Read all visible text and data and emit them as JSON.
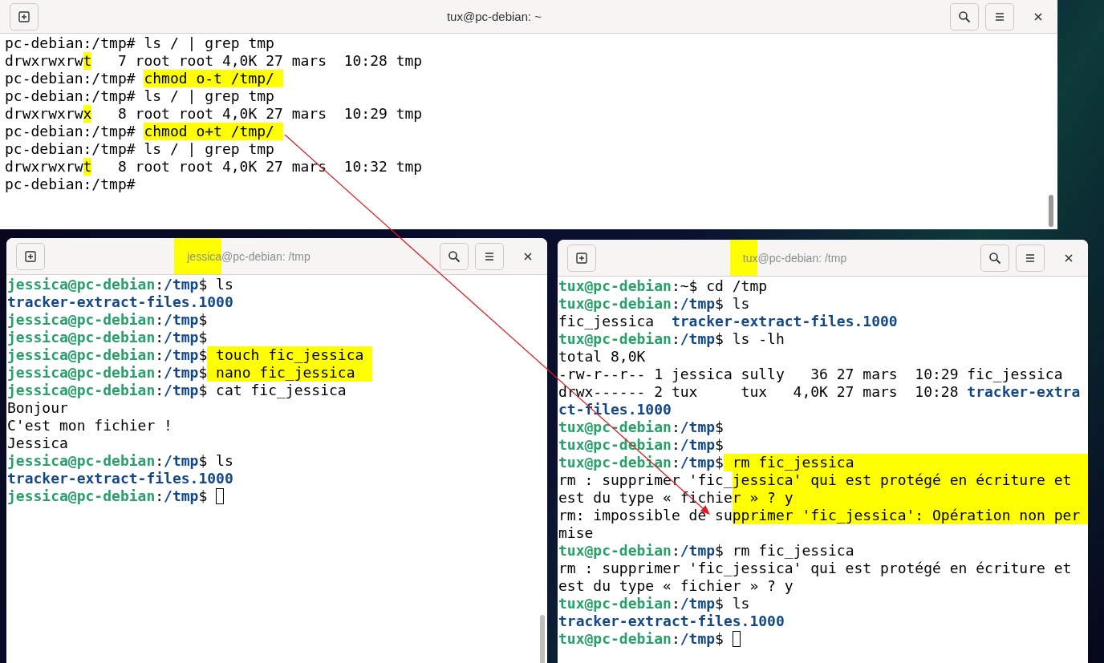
{
  "windows": [
    {
      "title": [
        {
          "text": "tux@pc-debian: ~",
          "kind": "plain"
        }
      ],
      "lines": [
        {
          "segments": [
            {
              "text": "pc-debian:/tmp# ls / | grep tmp",
              "kind": "plain"
            }
          ]
        },
        {
          "segments": [
            {
              "text": "drwxrwxrw",
              "kind": "plain"
            },
            {
              "text": "t",
              "kind": "marked"
            },
            {
              "text": "   7 root root 4,0K 27 mars  10:28 tmp",
              "kind": "plain"
            }
          ]
        },
        {
          "segments": [
            {
              "text": "pc-debian:/tmp# ",
              "kind": "plain"
            },
            {
              "text": "chmod o-t /tmp/ ",
              "kind": "marked"
            }
          ]
        },
        {
          "segments": [
            {
              "text": "pc-debian:/tmp# ls / | grep tmp",
              "kind": "plain"
            }
          ]
        },
        {
          "segments": [
            {
              "text": "drwxrwxrw",
              "kind": "plain"
            },
            {
              "text": "x",
              "kind": "marked"
            },
            {
              "text": "   8 root root 4,0K 27 mars  10:29 tmp",
              "kind": "plain"
            }
          ]
        },
        {
          "segments": [
            {
              "text": "pc-debian:/tmp# ",
              "kind": "plain"
            },
            {
              "text": "chmod o+t /tmp/ ",
              "kind": "marked"
            }
          ]
        },
        {
          "segments": [
            {
              "text": "pc-debian:/tmp# ls / | grep tmp",
              "kind": "plain"
            }
          ]
        },
        {
          "segments": [
            {
              "text": "drwxrwxrw",
              "kind": "plain"
            },
            {
              "text": "t",
              "kind": "marked"
            },
            {
              "text": "   8 root root 4,0K 27 mars  10:32 tmp",
              "kind": "plain"
            }
          ]
        },
        {
          "segments": [
            {
              "text": "pc-debian:/tmp#",
              "kind": "plain"
            }
          ]
        }
      ]
    },
    {
      "title": [
        {
          "text": "jessica",
          "kind": "marked"
        },
        {
          "text": "@pc-debian: /tmp",
          "kind": "plain"
        }
      ],
      "lines": [
        {
          "segments": [
            {
              "text": "jessica@pc-debian",
              "kind": "user"
            },
            {
              "text": ":",
              "kind": "plain"
            },
            {
              "text": "/tmp",
              "kind": "path"
            },
            {
              "text": "$ ls",
              "kind": "plain"
            }
          ]
        },
        {
          "segments": [
            {
              "text": "tracker-extract-files.1000",
              "kind": "dir"
            }
          ]
        },
        {
          "segments": [
            {
              "text": "jessica@pc-debian",
              "kind": "user"
            },
            {
              "text": ":",
              "kind": "plain"
            },
            {
              "text": "/tmp",
              "kind": "path"
            },
            {
              "text": "$",
              "kind": "plain"
            }
          ]
        },
        {
          "segments": [
            {
              "text": "jessica@pc-debian",
              "kind": "user"
            },
            {
              "text": ":",
              "kind": "plain"
            },
            {
              "text": "/tmp",
              "kind": "path"
            },
            {
              "text": "$",
              "kind": "plain"
            }
          ]
        },
        {
          "segments": [
            {
              "text": "jessica@pc-debian",
              "kind": "user"
            },
            {
              "text": ":",
              "kind": "plain"
            },
            {
              "text": "/tmp",
              "kind": "path"
            },
            {
              "text": "$",
              "kind": "plain"
            },
            {
              "text": " touch fic_jessica ",
              "kind": "marked"
            }
          ]
        },
        {
          "segments": [
            {
              "text": "jessica@pc-debian",
              "kind": "user"
            },
            {
              "text": ":",
              "kind": "plain"
            },
            {
              "text": "/tmp",
              "kind": "path"
            },
            {
              "text": "$",
              "kind": "plain"
            },
            {
              "text": " nano fic_jessica  ",
              "kind": "marked"
            }
          ]
        },
        {
          "segments": [
            {
              "text": "jessica@pc-debian",
              "kind": "user"
            },
            {
              "text": ":",
              "kind": "plain"
            },
            {
              "text": "/tmp",
              "kind": "path"
            },
            {
              "text": "$ cat fic_jessica",
              "kind": "plain"
            }
          ]
        },
        {
          "segments": [
            {
              "text": "Bonjour",
              "kind": "plain"
            }
          ]
        },
        {
          "segments": [
            {
              "text": "C'est mon fichier !",
              "kind": "plain"
            }
          ]
        },
        {
          "segments": [
            {
              "text": "Jessica",
              "kind": "plain"
            }
          ]
        },
        {
          "segments": [
            {
              "text": "jessica@pc-debian",
              "kind": "user"
            },
            {
              "text": ":",
              "kind": "plain"
            },
            {
              "text": "/tmp",
              "kind": "path"
            },
            {
              "text": "$ ls",
              "kind": "plain"
            }
          ]
        },
        {
          "segments": [
            {
              "text": "tracker-extract-files.1000",
              "kind": "dir"
            }
          ]
        },
        {
          "segments": [
            {
              "text": "jessica@pc-debian",
              "kind": "user"
            },
            {
              "text": ":",
              "kind": "plain"
            },
            {
              "text": "/tmp",
              "kind": "path"
            },
            {
              "text": "$ ",
              "kind": "plain"
            }
          ],
          "cursor": true
        }
      ]
    },
    {
      "title": [
        {
          "text": "tux",
          "kind": "marked"
        },
        {
          "text": "@pc-debian: /tmp",
          "kind": "plain"
        }
      ],
      "lines": [
        {
          "segments": [
            {
              "text": "tux@pc-debian",
              "kind": "user"
            },
            {
              "text": ":~$ cd /tmp",
              "kind": "plain"
            }
          ]
        },
        {
          "segments": [
            {
              "text": "tux@pc-debian",
              "kind": "user"
            },
            {
              "text": ":",
              "kind": "plain"
            },
            {
              "text": "/tmp",
              "kind": "path"
            },
            {
              "text": "$ ls",
              "kind": "plain"
            }
          ]
        },
        {
          "segments": [
            {
              "text": "fic_jessica  ",
              "kind": "plain"
            },
            {
              "text": "tracker-extract-files.1000",
              "kind": "dir"
            }
          ]
        },
        {
          "segments": [
            {
              "text": "tux@pc-debian",
              "kind": "user"
            },
            {
              "text": ":",
              "kind": "plain"
            },
            {
              "text": "/tmp",
              "kind": "path"
            },
            {
              "text": "$ ls -lh",
              "kind": "plain"
            }
          ]
        },
        {
          "segments": [
            {
              "text": "total 8,0K",
              "kind": "plain"
            }
          ]
        },
        {
          "segments": [
            {
              "text": "-rw-r--r-- 1 jessica sully   36 27 mars  10:29 fic_jessica",
              "kind": "plain"
            }
          ]
        },
        {
          "segments": [
            {
              "text": "drwx------ 2 tux     tux   4,0K 27 mars  10:28 ",
              "kind": "plain"
            },
            {
              "text": "tracker-extra",
              "kind": "dir"
            }
          ]
        },
        {
          "segments": [
            {
              "text": "ct-files.1000",
              "kind": "dir"
            }
          ]
        },
        {
          "segments": [
            {
              "text": "tux@pc-debian",
              "kind": "user"
            },
            {
              "text": ":",
              "kind": "plain"
            },
            {
              "text": "/tmp",
              "kind": "path"
            },
            {
              "text": "$",
              "kind": "plain"
            }
          ]
        },
        {
          "segments": [
            {
              "text": "tux@pc-debian",
              "kind": "user"
            },
            {
              "text": ":",
              "kind": "plain"
            },
            {
              "text": "/tmp",
              "kind": "path"
            },
            {
              "text": "$",
              "kind": "plain"
            }
          ]
        },
        {
          "segments": [
            {
              "text": "tux@pc-debian",
              "kind": "user"
            },
            {
              "text": ":",
              "kind": "plain"
            },
            {
              "text": "/tmp",
              "kind": "path"
            },
            {
              "text": "$",
              "kind": "plain"
            },
            {
              "text": " rm fic_jessica",
              "kind": "band"
            }
          ]
        },
        {
          "segments": [
            {
              "text": "rm : supprimer 'fic_",
              "kind": "plain"
            },
            {
              "text": "jessica' qui est protégé en écriture et",
              "kind": "band"
            }
          ]
        },
        {
          "segments": [
            {
              "text": "est du type « fichie",
              "kind": "plain"
            },
            {
              "text": "r » ? y",
              "kind": "band"
            }
          ]
        },
        {
          "segments": [
            {
              "text": "rm: impossible de su",
              "kind": "plain"
            },
            {
              "text": "pprimer 'fic_jessica': Opération non per",
              "kind": "band"
            }
          ]
        },
        {
          "segments": [
            {
              "text": "mise",
              "kind": "plain"
            }
          ]
        },
        {
          "segments": [
            {
              "text": "tux@pc-debian",
              "kind": "user"
            },
            {
              "text": ":",
              "kind": "plain"
            },
            {
              "text": "/tmp",
              "kind": "path"
            },
            {
              "text": "$ rm fic_jessica",
              "kind": "plain"
            }
          ]
        },
        {
          "segments": [
            {
              "text": "rm : supprimer 'fic_jessica' qui est protégé en écriture et",
              "kind": "plain"
            }
          ]
        },
        {
          "segments": [
            {
              "text": "est du type « fichier » ? y",
              "kind": "plain"
            }
          ]
        },
        {
          "segments": [
            {
              "text": "tux@pc-debian",
              "kind": "user"
            },
            {
              "text": ":",
              "kind": "plain"
            },
            {
              "text": "/tmp",
              "kind": "path"
            },
            {
              "text": "$ ls",
              "kind": "plain"
            }
          ]
        },
        {
          "segments": [
            {
              "text": "tracker-extract-files.1000",
              "kind": "dir"
            }
          ]
        },
        {
          "segments": [
            {
              "text": "tux@pc-debian",
              "kind": "user"
            },
            {
              "text": ":",
              "kind": "plain"
            },
            {
              "text": "/tmp",
              "kind": "path"
            },
            {
              "text": "$ ",
              "kind": "plain"
            }
          ],
          "cursor": true
        }
      ]
    }
  ]
}
